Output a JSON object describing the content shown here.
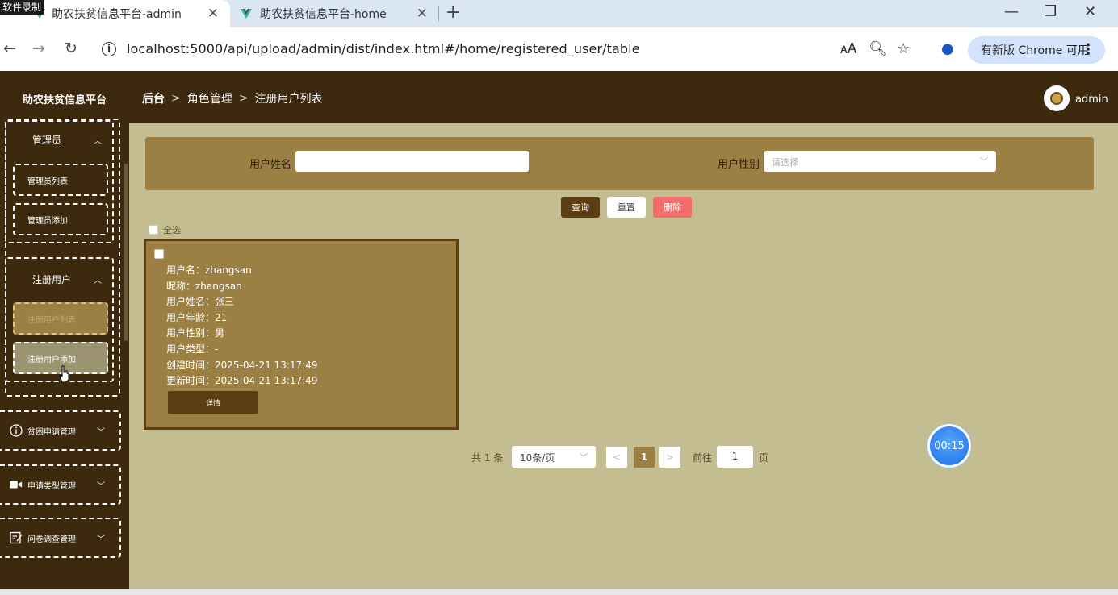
{
  "recorder_label": "软件录制",
  "tabs": [
    {
      "title": "助农扶贫信息平台-admin"
    },
    {
      "title": "助农扶贫信息平台-home"
    }
  ],
  "address": {
    "url": "localhost:5000/api/upload/admin/dist/index.html#/home/registered_user/table",
    "update_label": "有新版 Chrome 可用"
  },
  "header": {
    "brand": "助农扶贫信息平台",
    "breadcrumb": [
      "后台",
      "角色管理",
      "注册用户列表"
    ],
    "username": "admin"
  },
  "sidebar": {
    "groups": [
      {
        "title": "管理员",
        "items": [
          "管理员列表",
          "管理员添加"
        ]
      },
      {
        "title": "注册用户",
        "items": [
          "注册用户列表",
          "注册用户添加"
        ]
      }
    ],
    "menus": [
      {
        "label": "贫困申请管理",
        "icon": "info-circle-icon"
      },
      {
        "label": "申请类型管理",
        "icon": "video-camera-icon"
      },
      {
        "label": "问卷调查管理",
        "icon": "edit-document-icon"
      }
    ]
  },
  "search": {
    "name_label": "用户姓名",
    "name_value": "",
    "gender_label": "用户性别",
    "gender_placeholder": "请选择",
    "query_label": "查询",
    "reset_label": "重置",
    "delete_label": "删除",
    "select_all_label": "全选"
  },
  "records": [
    {
      "lines": [
        "用户名：zhangsan",
        "昵称：zhangsan",
        "用户姓名：张三",
        "用户年龄：21",
        "用户性别：男",
        "用户类型：-",
        "创建时间：2025-04-21 13:17:49",
        "更新时间：2025-04-21 13:17:49"
      ],
      "detail_label": "详情"
    }
  ],
  "pagination": {
    "total_text": "共 1 条",
    "page_size": "10条/页",
    "prev": "<",
    "current_page": "1",
    "next": ">",
    "goto_label": "前往",
    "goto_value": "1",
    "page_suffix": "页"
  },
  "timer": "00:15",
  "colors": {
    "header_bg": "#3d2a0e",
    "content_bg": "#c5bd92",
    "panel_bg": "#9c7f42",
    "danger": "#f56c6c"
  }
}
